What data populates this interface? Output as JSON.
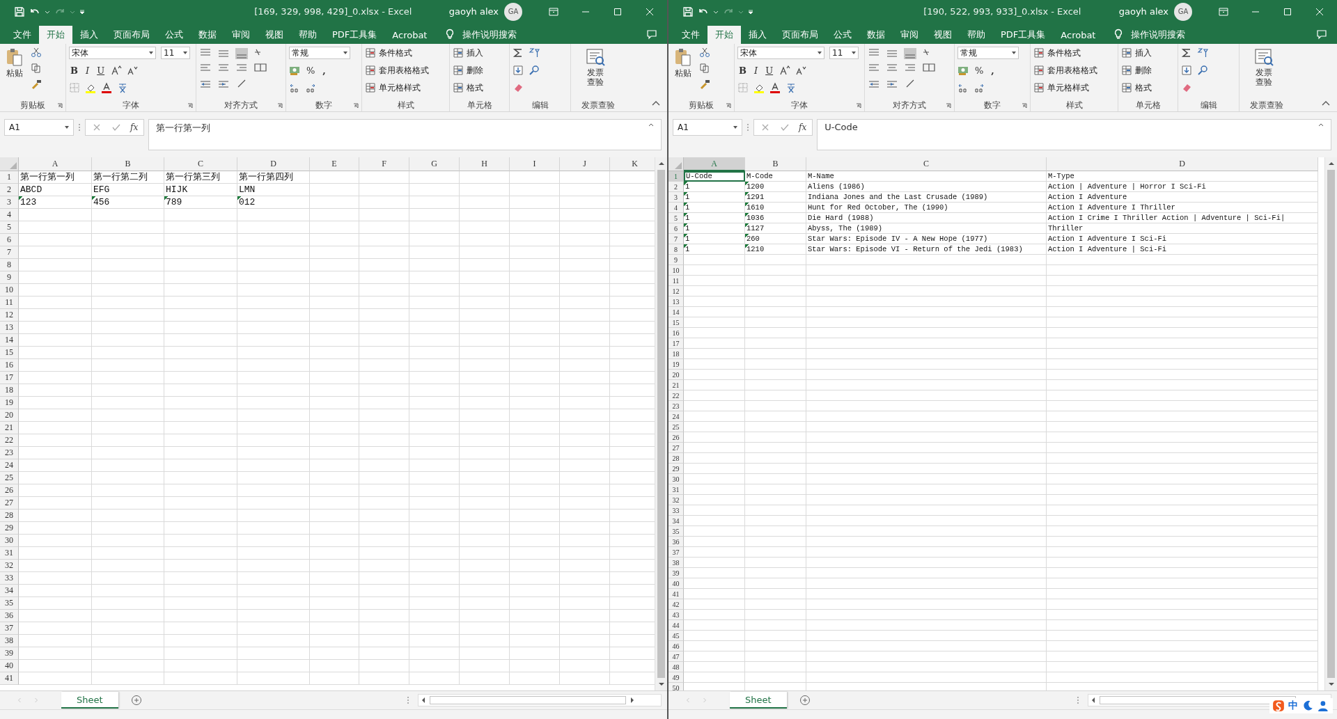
{
  "windows": [
    {
      "title": "[169, 329, 998, 429]_0.xlsx  -  Excel",
      "user": "gaoyh alex",
      "avatar": "GA",
      "tabs": [
        {
          "label": "文件",
          "selected": false
        },
        {
          "label": "开始",
          "selected": true
        },
        {
          "label": "插入",
          "selected": false
        },
        {
          "label": "页面布局",
          "selected": false
        },
        {
          "label": "公式",
          "selected": false
        },
        {
          "label": "数据",
          "selected": false
        },
        {
          "label": "审阅",
          "selected": false
        },
        {
          "label": "视图",
          "selected": false
        },
        {
          "label": "帮助",
          "selected": false
        },
        {
          "label": "PDF工具集",
          "selected": false
        },
        {
          "label": "Acrobat",
          "selected": false
        }
      ],
      "tell_me": "操作说明搜索",
      "ribbon": [
        {
          "kind": "clipboard",
          "label": "剪贴板",
          "launcher": true,
          "paste": "粘贴"
        },
        {
          "kind": "font",
          "label": "字体",
          "launcher": true,
          "font_name": "宋体",
          "font_size": "11",
          "bold": "B",
          "italic": "I",
          "underline": "U"
        },
        {
          "kind": "alignment",
          "label": "对齐方式",
          "launcher": true
        },
        {
          "kind": "number",
          "label": "数字",
          "launcher": true,
          "format": "常规",
          "percent": "%",
          "comma": ","
        },
        {
          "kind": "styles",
          "label": "样式",
          "launcher": false,
          "items": [
            "条件格式",
            "套用表格格式",
            "单元格样式"
          ]
        },
        {
          "kind": "cells",
          "label": "单元格",
          "launcher": false,
          "items": [
            "插入",
            "删除",
            "格式"
          ]
        },
        {
          "kind": "editing",
          "label": "编辑",
          "launcher": false
        },
        {
          "kind": "invoice",
          "label": "发票查验",
          "launcher": false,
          "button": "发票查验"
        }
      ],
      "name_box": "A1",
      "fx": "fx",
      "formula": "第一行第一列",
      "columns": [
        {
          "label": "A",
          "selected": false
        },
        {
          "label": "B",
          "selected": false
        },
        {
          "label": "C",
          "selected": false
        },
        {
          "label": "D",
          "selected": false
        },
        {
          "label": "E",
          "selected": false
        },
        {
          "label": "F",
          "selected": false
        },
        {
          "label": "G",
          "selected": false
        },
        {
          "label": "H",
          "selected": false
        },
        {
          "label": "I",
          "selected": false
        },
        {
          "label": "J",
          "selected": false
        },
        {
          "label": "K",
          "selected": false
        }
      ],
      "rows": [
        {
          "number": "1",
          "selected": false,
          "cells": [
            {
              "text": "第一行第一列",
              "warning": false
            },
            {
              "text": "第一行第二列",
              "warning": false
            },
            {
              "text": "第一行第三列",
              "warning": false
            },
            {
              "text": "第一行第四列",
              "warning": false
            }
          ]
        },
        {
          "number": "2",
          "selected": false,
          "cells": [
            {
              "text": "ABCD",
              "warning": false
            },
            {
              "text": "EFG",
              "warning": false
            },
            {
              "text": "HIJK",
              "warning": false
            },
            {
              "text": "LMN",
              "warning": false
            }
          ]
        },
        {
          "number": "3",
          "selected": false,
          "cells": [
            {
              "text": "123",
              "warning": true
            },
            {
              "text": "456",
              "warning": true
            },
            {
              "text": "789",
              "warning": true
            },
            {
              "text": "012",
              "warning": true
            }
          ]
        },
        {
          "number": "4",
          "selected": false
        },
        {
          "number": "5",
          "selected": false
        },
        {
          "number": "6",
          "selected": false
        },
        {
          "number": "7",
          "selected": false
        },
        {
          "number": "8",
          "selected": false
        },
        {
          "number": "9",
          "selected": false
        },
        {
          "number": "10",
          "selected": false
        },
        {
          "number": "11",
          "selected": false
        },
        {
          "number": "12",
          "selected": false
        },
        {
          "number": "13",
          "selected": false
        },
        {
          "number": "14",
          "selected": false
        },
        {
          "number": "15",
          "selected": false
        },
        {
          "number": "16",
          "selected": false
        },
        {
          "number": "17",
          "selected": false
        },
        {
          "number": "18",
          "selected": false
        },
        {
          "number": "19",
          "selected": false
        },
        {
          "number": "20",
          "selected": false
        },
        {
          "number": "21",
          "selected": false
        },
        {
          "number": "22",
          "selected": false
        },
        {
          "number": "23",
          "selected": false
        },
        {
          "number": "24",
          "selected": false
        },
        {
          "number": "25",
          "selected": false
        },
        {
          "number": "26",
          "selected": false
        },
        {
          "number": "27",
          "selected": false
        },
        {
          "number": "28",
          "selected": false
        },
        {
          "number": "29",
          "selected": false
        },
        {
          "number": "30",
          "selected": false
        },
        {
          "number": "31",
          "selected": false
        },
        {
          "number": "32",
          "selected": false
        },
        {
          "number": "33",
          "selected": false
        },
        {
          "number": "34",
          "selected": false
        },
        {
          "number": "35",
          "selected": false
        },
        {
          "number": "36",
          "selected": false
        },
        {
          "number": "37",
          "selected": false
        },
        {
          "number": "38",
          "selected": false
        },
        {
          "number": "39",
          "selected": false
        },
        {
          "number": "40",
          "selected": false
        },
        {
          "number": "41",
          "selected": false
        }
      ],
      "sheets": [
        {
          "label": "Sheet",
          "selected": true
        }
      ]
    },
    {
      "title": "[190, 522, 993, 933]_0.xlsx  -  Excel",
      "user": "gaoyh alex",
      "avatar": "GA",
      "tabs": [
        {
          "label": "文件",
          "selected": false
        },
        {
          "label": "开始",
          "selected": true
        },
        {
          "label": "插入",
          "selected": false
        },
        {
          "label": "页面布局",
          "selected": false
        },
        {
          "label": "公式",
          "selected": false
        },
        {
          "label": "数据",
          "selected": false
        },
        {
          "label": "审阅",
          "selected": false
        },
        {
          "label": "视图",
          "selected": false
        },
        {
          "label": "帮助",
          "selected": false
        },
        {
          "label": "PDF工具集",
          "selected": false
        },
        {
          "label": "Acrobat",
          "selected": false
        }
      ],
      "tell_me": "操作说明搜索",
      "ribbon": [
        {
          "kind": "clipboard",
          "label": "剪贴板",
          "launcher": true,
          "paste": "粘贴"
        },
        {
          "kind": "font",
          "label": "字体",
          "launcher": true,
          "font_name": "宋体",
          "font_size": "11",
          "bold": "B",
          "italic": "I",
          "underline": "U"
        },
        {
          "kind": "alignment",
          "label": "对齐方式",
          "launcher": true
        },
        {
          "kind": "number",
          "label": "数字",
          "launcher": true,
          "format": "常规",
          "percent": "%",
          "comma": ","
        },
        {
          "kind": "styles",
          "label": "样式",
          "launcher": false,
          "items": [
            "条件格式",
            "套用表格格式",
            "单元格样式"
          ]
        },
        {
          "kind": "cells",
          "label": "单元格",
          "launcher": false,
          "items": [
            "插入",
            "删除",
            "格式"
          ]
        },
        {
          "kind": "editing",
          "label": "编辑",
          "launcher": false
        },
        {
          "kind": "invoice",
          "label": "发票查验",
          "launcher": false,
          "button": "发票查验"
        }
      ],
      "name_box": "A1",
      "fx": "fx",
      "formula": "U-Code",
      "columns": [
        {
          "label": "A",
          "selected": true
        },
        {
          "label": "B",
          "selected": false
        },
        {
          "label": "C",
          "selected": false
        },
        {
          "label": "D",
          "selected": false
        }
      ],
      "rows": [
        {
          "number": "1",
          "selected": true,
          "cells": [
            {
              "text": "U-Code",
              "warning": false
            },
            {
              "text": "M-Code",
              "warning": false
            },
            {
              "text": "M-Name",
              "warning": false
            },
            {
              "text": "M-Type",
              "warning": false
            }
          ]
        },
        {
          "number": "2",
          "selected": false,
          "cells": [
            {
              "text": "1",
              "warning": true
            },
            {
              "text": "1200",
              "warning": true
            },
            {
              "text": "Aliens (1986)",
              "warning": false
            },
            {
              "text": "Action | Adventure | Horror I Sci-Fi",
              "warning": false
            }
          ]
        },
        {
          "number": "3",
          "selected": false,
          "cells": [
            {
              "text": "1",
              "warning": true
            },
            {
              "text": "1291",
              "warning": true
            },
            {
              "text": "Indiana Jones and the Last Crusade (1989)",
              "warning": false
            },
            {
              "text": "Action I Adventure",
              "warning": false
            }
          ]
        },
        {
          "number": "4",
          "selected": false,
          "cells": [
            {
              "text": "1",
              "warning": true
            },
            {
              "text": "1610",
              "warning": true
            },
            {
              "text": "Hunt for Red October, The (1990)",
              "warning": false
            },
            {
              "text": "Action I Adventure I Thriller",
              "warning": false
            }
          ]
        },
        {
          "number": "5",
          "selected": false,
          "cells": [
            {
              "text": "1",
              "warning": true
            },
            {
              "text": "1036",
              "warning": true
            },
            {
              "text": "Die Hard (1988)",
              "warning": false
            },
            {
              "text": "Action I Crime I Thriller Action | Adventure | Sci-Fi|",
              "warning": false
            }
          ]
        },
        {
          "number": "6",
          "selected": false,
          "cells": [
            {
              "text": "1",
              "warning": true
            },
            {
              "text": "1127",
              "warning": true
            },
            {
              "text": "Abyss, The (1989)",
              "warning": false
            },
            {
              "text": "Thriller",
              "warning": false
            }
          ]
        },
        {
          "number": "7",
          "selected": false,
          "cells": [
            {
              "text": "1",
              "warning": true
            },
            {
              "text": "260",
              "warning": true
            },
            {
              "text": "Star Wars: Episode IV - A New Hope (1977)",
              "warning": false
            },
            {
              "text": "Action I Adventure I Sci-Fi",
              "warning": false
            }
          ]
        },
        {
          "number": "8",
          "selected": false,
          "cells": [
            {
              "text": "1",
              "warning": true
            },
            {
              "text": "1210",
              "warning": true
            },
            {
              "text": "Star Wars: Episode VI - Return of the Jedi (1983)",
              "warning": false
            },
            {
              "text": "Action I Adventure | Sci-Fi",
              "warning": false
            }
          ]
        },
        {
          "number": "9",
          "selected": false
        },
        {
          "number": "10",
          "selected": false
        },
        {
          "number": "11",
          "selected": false
        },
        {
          "number": "12",
          "selected": false
        },
        {
          "number": "13",
          "selected": false
        },
        {
          "number": "14",
          "selected": false
        },
        {
          "number": "15",
          "selected": false
        },
        {
          "number": "16",
          "selected": false
        },
        {
          "number": "17",
          "selected": false
        },
        {
          "number": "18",
          "selected": false
        },
        {
          "number": "19",
          "selected": false
        },
        {
          "number": "20",
          "selected": false
        },
        {
          "number": "21",
          "selected": false
        },
        {
          "number": "22",
          "selected": false
        },
        {
          "number": "23",
          "selected": false
        },
        {
          "number": "24",
          "selected": false
        },
        {
          "number": "25",
          "selected": false
        },
        {
          "number": "26",
          "selected": false
        },
        {
          "number": "27",
          "selected": false
        },
        {
          "number": "28",
          "selected": false
        },
        {
          "number": "29",
          "selected": false
        },
        {
          "number": "30",
          "selected": false
        },
        {
          "number": "31",
          "selected": false
        },
        {
          "number": "32",
          "selected": false
        },
        {
          "number": "33",
          "selected": false
        },
        {
          "number": "34",
          "selected": false
        },
        {
          "number": "35",
          "selected": false
        },
        {
          "number": "36",
          "selected": false
        },
        {
          "number": "37",
          "selected": false
        },
        {
          "number": "38",
          "selected": false
        },
        {
          "number": "39",
          "selected": false
        },
        {
          "number": "40",
          "selected": false
        },
        {
          "number": "41",
          "selected": false
        },
        {
          "number": "42",
          "selected": false
        },
        {
          "number": "43",
          "selected": false
        },
        {
          "number": "44",
          "selected": false
        },
        {
          "number": "45",
          "selected": false
        },
        {
          "number": "46",
          "selected": false
        },
        {
          "number": "47",
          "selected": false
        },
        {
          "number": "48",
          "selected": false
        },
        {
          "number": "49",
          "selected": false
        },
        {
          "number": "50",
          "selected": false
        }
      ],
      "sheets": [
        {
          "label": "Sheet",
          "selected": true
        }
      ],
      "ime": {
        "label": "中"
      }
    }
  ]
}
